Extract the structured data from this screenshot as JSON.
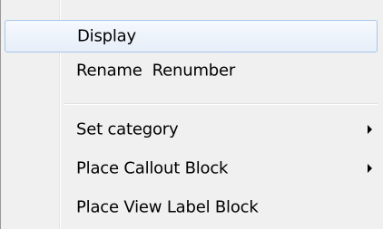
{
  "menu": {
    "items": [
      {
        "label": "Display",
        "highlighted": true,
        "submenu": false
      },
      {
        "label": "Rename  Renumber",
        "highlighted": false,
        "submenu": false
      },
      {
        "label": "Set category",
        "highlighted": false,
        "submenu": true,
        "arrow_icon": "submenu-arrow-icon"
      },
      {
        "label": "Place Callout Block",
        "highlighted": false,
        "submenu": true,
        "arrow_icon": "submenu-arrow-icon"
      },
      {
        "label": "Place View Label Block",
        "highlighted": false,
        "submenu": false
      }
    ]
  },
  "colors": {
    "menu_background": "#f0f0f0",
    "highlight_border": "#a8c6ea",
    "highlight_fill": "#e6eef9",
    "text": "#000000"
  }
}
